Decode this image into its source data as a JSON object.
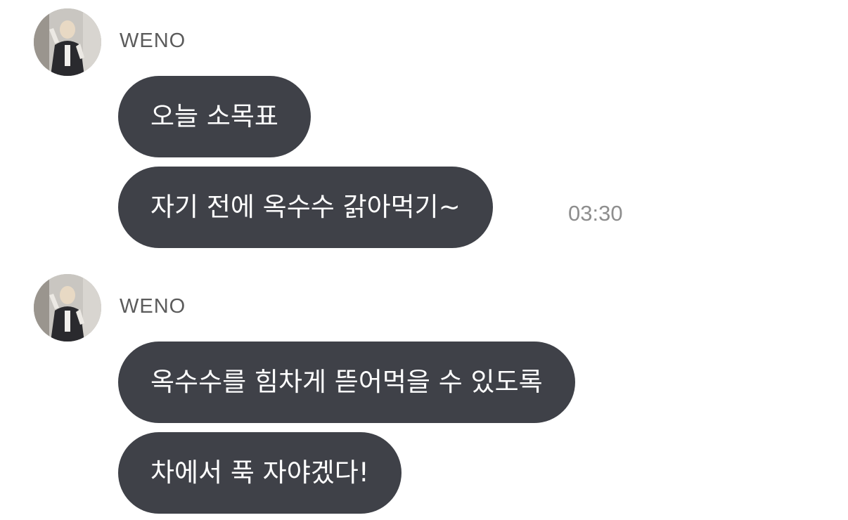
{
  "colors": {
    "bubble_background": "#3f4148",
    "bubble_text": "#ffffff",
    "sender_name": "#5b5b5b",
    "timestamp": "#8e8e8e"
  },
  "groups": [
    {
      "sender": "WENO",
      "avatar_icon": "user-avatar-photo",
      "messages": [
        {
          "text": "오늘 소목표"
        },
        {
          "text": "자기 전에 옥수수 갉아먹기~",
          "time": "03:30"
        }
      ]
    },
    {
      "sender": "WENO",
      "avatar_icon": "user-avatar-photo",
      "messages": [
        {
          "text": "옥수수를 힘차게 뜯어먹을 수 있도록"
        },
        {
          "text": "차에서 푹 자야겠다!"
        }
      ]
    }
  ]
}
